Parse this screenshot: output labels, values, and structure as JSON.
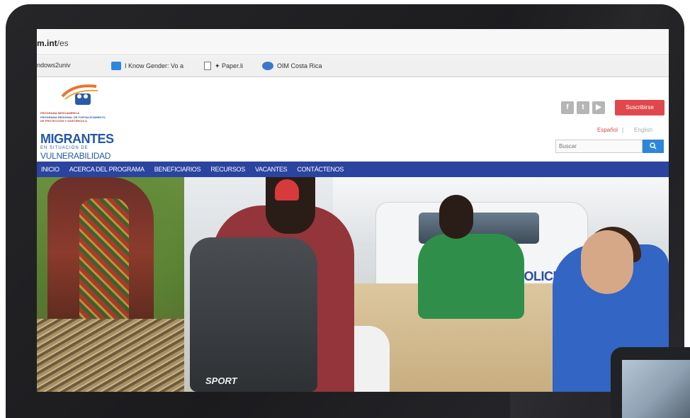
{
  "browser": {
    "url_host": "m.int",
    "url_path": "/es",
    "bookmarks": [
      {
        "label": "ndows2univ",
        "icon": "page-icon"
      },
      {
        "label": "I Know Gender: Vo a",
        "icon": "app-icon"
      },
      {
        "label": "✦ Paper.li",
        "icon": "page-icon"
      },
      {
        "label": "OIM Costa Rica",
        "icon": "oim-icon"
      }
    ]
  },
  "site": {
    "logo_small_lines": [
      "PROGRAMA MESOAMÉRICA",
      "PROGRAMA REGIONAL DE FORTALECIMIENTO",
      "DE PROTECCIÓN Y ASISTENCIA A"
    ],
    "logo_main": "MIGRANTES",
    "logo_sub": "EN SITUACIÓN DE",
    "logo_bottom": "VULNERABILIDAD",
    "social": [
      {
        "icon": "facebook-icon",
        "glyph": "f"
      },
      {
        "icon": "twitter-icon",
        "glyph": "t"
      },
      {
        "icon": "youtube-icon",
        "glyph": "▶"
      }
    ],
    "subscribe_label": "Suscribirse",
    "lang_es": "Español",
    "lang_sep": "|",
    "lang_en": "English",
    "search_placeholder": "Buscar",
    "search_icon": "search-icon"
  },
  "nav": {
    "items": [
      "INICIO",
      "ACERCA DEL PROGRAMA",
      "BENEFICIARIOS",
      "RECURSOS",
      "VACANTES",
      "CONTÁCTENOS"
    ]
  },
  "hero": {
    "sign_text": "POLICIA",
    "backpack_text": "SPORT"
  },
  "colors": {
    "nav_bg": "#2a44a0",
    "subscribe_bg": "#e0484e",
    "brand_blue": "#2457a6",
    "bezel": "#1e1e21"
  }
}
